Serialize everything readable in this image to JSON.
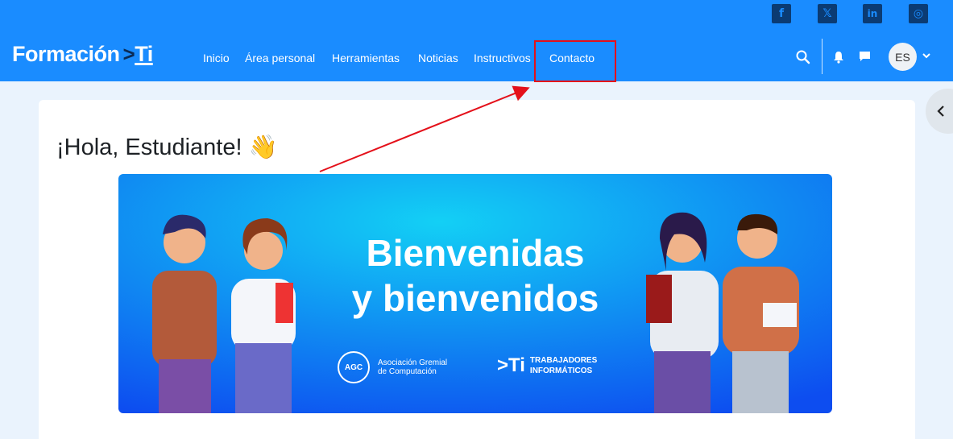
{
  "header": {
    "logo_text": "Formación",
    "logo_chevron": ">",
    "logo_ti": "Ti",
    "nav": [
      "Inicio",
      "Área personal",
      "Herramientas",
      "Noticias",
      "Instructivos",
      "Contacto"
    ],
    "user_initials": "ES",
    "social": [
      "facebook-icon",
      "x-icon",
      "linkedin-icon",
      "instagram-icon"
    ],
    "social_glyphs": [
      "f",
      "𝕏",
      "in",
      "◎"
    ]
  },
  "main": {
    "greeting": "¡Hola, Estudiante! 👋"
  },
  "banner": {
    "title_line1": "Bienvenidas",
    "title_line2": "y bienvenidos",
    "org1_logo": "AGC",
    "org1_line1": "Asociación Gremial",
    "org1_line2": "de Computación",
    "org2_logo": ">Ti",
    "org2_line1": "TRABAJADORES",
    "org2_line2": "INFORMÁTICOS"
  },
  "colors": {
    "header_bg": "#1a8cff",
    "highlight": "#e4101a",
    "banner_start": "#13d0f5",
    "banner_end": "#0d4df0"
  }
}
